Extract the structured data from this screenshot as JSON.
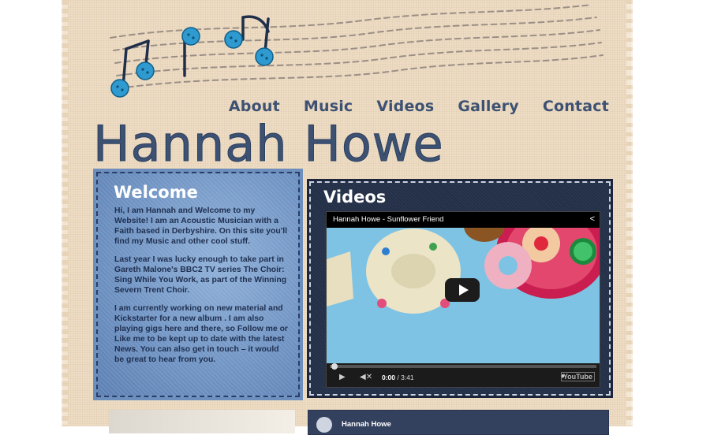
{
  "nav": {
    "items": [
      "About",
      "Music",
      "Videos",
      "Gallery",
      "Contact"
    ]
  },
  "header": {
    "title": "Hannah Howe"
  },
  "welcome": {
    "heading": "Welcome",
    "paragraphs": [
      "Hi, I am Hannah and Welcome to my Website! I am an Acoustic Musician with a Faith based in Derbyshire. On this site you'll find my Music and other cool stuff.",
      "Last year I was lucky enough to take part in Gareth Malone's BBC2 TV series The Choir: Sing While You Work, as part of the Winning Severn Trent Choir.",
      "I am currently working on new material and Kickstarter for a new album . I am also playing gigs here and there, so Follow me or Like me to be kept up to date with the latest News. You can also get in touch – it would be great to hear from you."
    ]
  },
  "videos": {
    "heading": "Videos",
    "video_title": "Hannah Howe - Sunflower Friend",
    "time_current": "0:00",
    "time_total": "/ 3:41",
    "brand": "YouTube"
  },
  "music_player": {
    "artist": "Hannah Howe"
  },
  "colors": {
    "navy_text": "#3d5273",
    "denim_light": "#7a9cc9",
    "denim_dark": "#232f47",
    "fabric": "#eedcc4",
    "button_blue": "#2e9ad0"
  }
}
